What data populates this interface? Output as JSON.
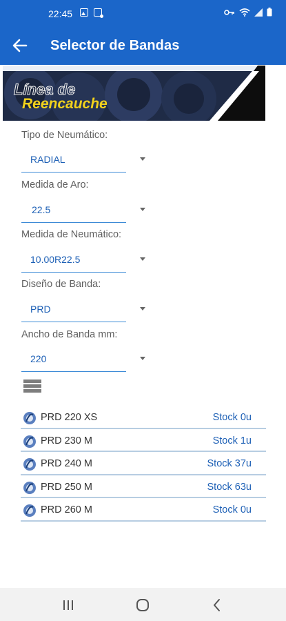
{
  "status_bar": {
    "time": "22:45",
    "icons_left": [
      "image-notification-icon",
      "message-notification-icon"
    ],
    "icons_right": [
      "key-icon",
      "wifi-icon",
      "signal-icon",
      "battery-icon"
    ]
  },
  "app_bar": {
    "title": "Selector de Bandas",
    "back_icon": "arrow-left-icon"
  },
  "banner": {
    "line1": "Línea de",
    "line2": "Reencauche",
    "colors": {
      "line1": "#e8e8e8",
      "line2": "#f2d21c",
      "bg": "#1f2b46"
    }
  },
  "form": {
    "fields": [
      {
        "label": "Tipo de Neumático:",
        "value": "RADIAL"
      },
      {
        "label": "Medida de Aro:",
        "value": "22.5"
      },
      {
        "label": "Medida de Neumático:",
        "value": "10.00R22.5"
      },
      {
        "label": "Diseño de Banda:",
        "value": "PRD"
      },
      {
        "label": "Ancho de Banda mm:",
        "value": "220"
      }
    ]
  },
  "list": {
    "icon": "list-view-icon",
    "items": [
      {
        "name": "PRD 220 XS",
        "stock": "Stock 0u"
      },
      {
        "name": "PRD 230 M",
        "stock": "Stock 1u"
      },
      {
        "name": "PRD 240 M",
        "stock": "Stock 37u"
      },
      {
        "name": "PRD 250 M",
        "stock": "Stock 63u"
      },
      {
        "name": "PRD 260 M",
        "stock": "Stock 0u"
      }
    ]
  },
  "nav_bar": {
    "buttons": [
      "recents-icon",
      "home-icon",
      "back-icon"
    ]
  },
  "colors": {
    "primary": "#1b66c9",
    "accent_text": "#1c5fb5",
    "divider": "#b7cde2"
  }
}
